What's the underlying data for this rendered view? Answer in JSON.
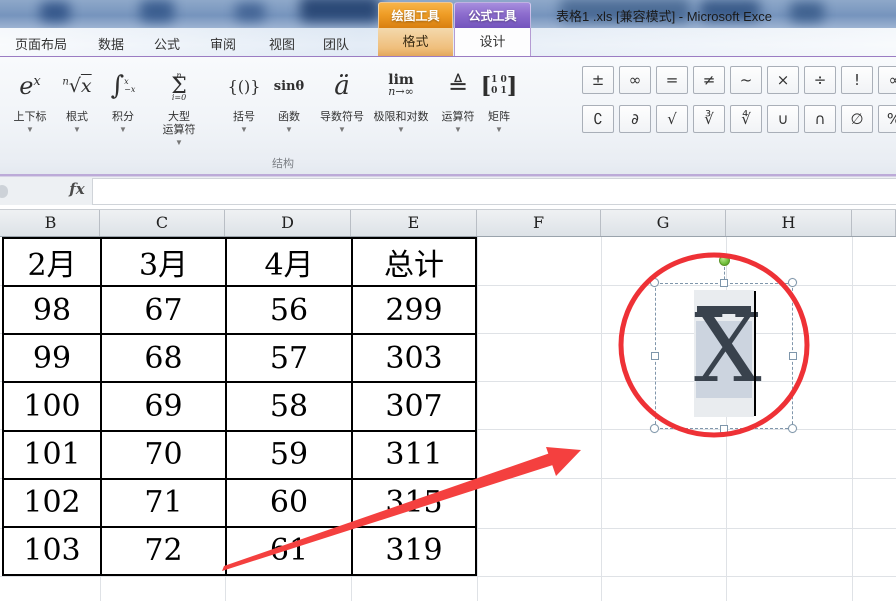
{
  "window": {
    "title": "表格1 .xls  [兼容模式]  -  Microsoft Exce",
    "contextual_groups": [
      {
        "label": "绘图工具",
        "color": "#ef9d26",
        "tab": "格式"
      },
      {
        "label": "公式工具",
        "color": "#8c6ccd",
        "tab": "设计"
      }
    ]
  },
  "tabs": {
    "items": [
      "页面布局",
      "数据",
      "公式",
      "审阅",
      "视图",
      "团队"
    ],
    "drawing_tab": "格式",
    "formula_tab": "设计",
    "active_tab": "设计"
  },
  "ribbon": {
    "group_label": "结构",
    "structures": [
      {
        "icon": "superscript-icon",
        "label": "上下标"
      },
      {
        "icon": "radical-icon",
        "label": "根式"
      },
      {
        "icon": "integral-icon",
        "label": "积分"
      },
      {
        "icon": "large-operator-icon",
        "label": "大型\n运算符"
      },
      {
        "icon": "bracket-icon",
        "label": "括号"
      },
      {
        "icon": "function-icon",
        "label": "函数"
      },
      {
        "icon": "accent-icon",
        "label": "导数符号"
      },
      {
        "icon": "limit-log-icon",
        "label": "极限和对数"
      },
      {
        "icon": "operator-icon",
        "label": "运算符"
      },
      {
        "icon": "matrix-icon",
        "label": "矩阵"
      }
    ],
    "symbols_row1": [
      "±",
      "∞",
      "=",
      "≠",
      "~",
      "×",
      "÷",
      "!",
      "∝"
    ],
    "symbols_row2": [
      "∁",
      "∂",
      "√",
      "∛",
      "∜",
      "∪",
      "∩",
      "∅",
      "%"
    ]
  },
  "formula_bar": {
    "fx_label": "fx",
    "value": ""
  },
  "sheet": {
    "column_headers": [
      "B",
      "C",
      "D",
      "E",
      "F",
      "G",
      "H"
    ],
    "table": {
      "headers": [
        "2月",
        "3月",
        "4月",
        "总计"
      ],
      "rows": [
        [
          "98",
          "67",
          "56",
          "299"
        ],
        [
          "99",
          "68",
          "57",
          "303"
        ],
        [
          "100",
          "69",
          "58",
          "307"
        ],
        [
          "101",
          "70",
          "59",
          "311"
        ],
        [
          "102",
          "71",
          "60",
          "315"
        ],
        [
          "103",
          "72",
          "61",
          "319"
        ]
      ]
    },
    "equation": {
      "symbol": "X",
      "accent": "overbar"
    }
  },
  "colors": {
    "formula_tools_accent": "#8c6ccd",
    "drawing_tools_accent": "#ef9d26",
    "annotation_red": "#ee3136",
    "equation_ink": "#39424d",
    "selection_handle": "#7e96ab",
    "rotation_handle_green": "#6fbf3b"
  }
}
